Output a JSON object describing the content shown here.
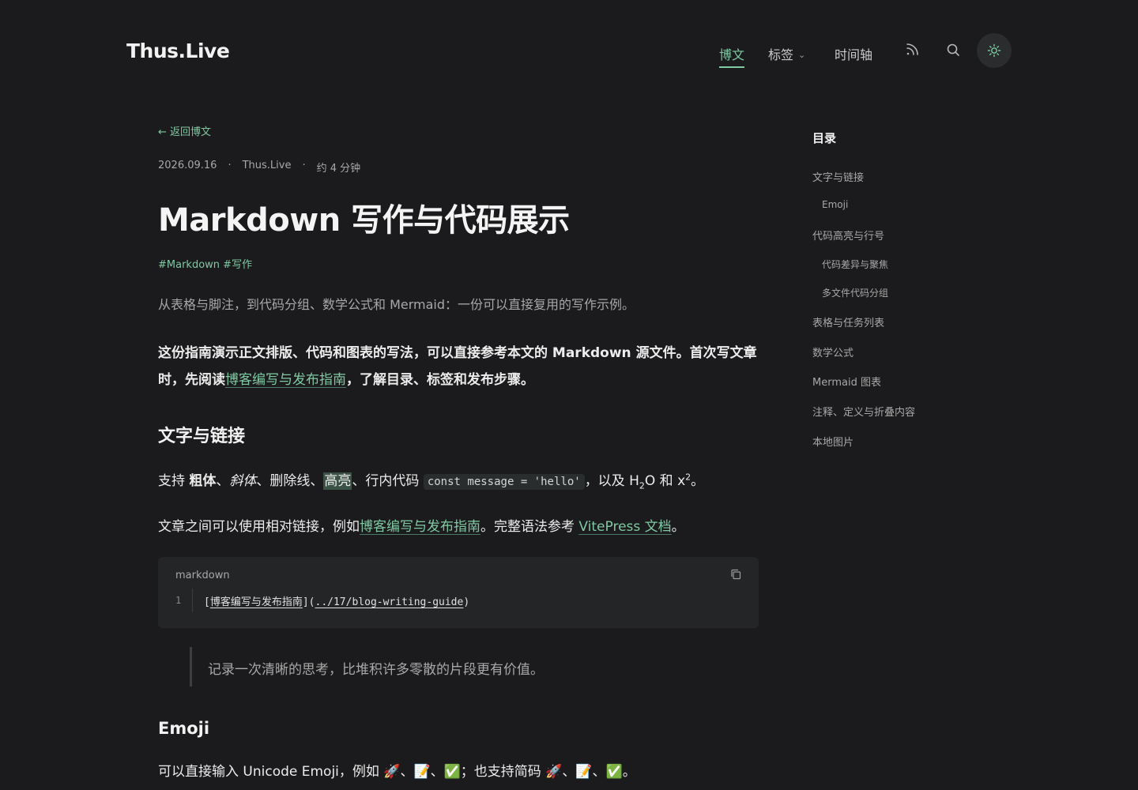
{
  "site": {
    "logo": "Thus.Live",
    "nav": {
      "posts": "博文",
      "tags": "标签",
      "timeline": "时间轴"
    },
    "icons": [
      "rss-icon",
      "search-icon",
      "sun-icon"
    ],
    "accent_color": "#7fc9a3"
  },
  "article": {
    "back_label": "← 返回博文",
    "meta": {
      "date": "2026.09.16",
      "author": "Thus.Live",
      "read_time": "约 4 分钟"
    },
    "title": "Markdown 写作与代码展示",
    "tags": [
      "#Markdown",
      "#写作"
    ],
    "summary": "从表格与脚注，到代码分组、数学公式和 Mermaid：一份可以直接复用的写作示例。",
    "intro": {
      "part1": "这份指南演示正文排版、代码和图表的写法，可以直接参考本文的 Markdown 源文件。首次写文章时，先阅读",
      "link": "博客编写与发布指南",
      "part2": "，了解目录、标签和发布步骤。"
    },
    "section1": {
      "heading": "文字与链接",
      "p1": {
        "t1": "支持 ",
        "bold": "粗体",
        "t2": "、",
        "italic": "斜体",
        "t3": "、",
        "strike": "删除线",
        "t4": "、",
        "mark": "高亮",
        "t5": "、行内代码 ",
        "code": "const message = 'hello'",
        "t6": "，以及 H",
        "sub": "2",
        "t7": "O 和 x",
        "sup": "2",
        "t8": "。"
      },
      "p2": {
        "t1": "文章之间可以使用相对链接，例如",
        "link1": "博客编写与发布指南",
        "t2": "。完整语法参考 ",
        "link2": "VitePress 文档",
        "t3": "。"
      },
      "code": {
        "lang": "markdown",
        "line_no": "1",
        "open_bracket": "[",
        "text": "博客编写与发布指南",
        "mid": "](",
        "url": "../17/blog-writing-guide",
        "close": ")"
      },
      "quote": "记录一次清晰的思考，比堆积许多零散的片段更有价值。"
    },
    "section2": {
      "heading": "Emoji",
      "p1": "可以直接输入 Unicode Emoji，例如 🚀、📝、✅；也支持简码 🚀、📝、✅。"
    }
  },
  "toc": {
    "title": "目录",
    "items": [
      {
        "label": "文字与链接",
        "level": 1
      },
      {
        "label": "Emoji",
        "level": 2
      },
      {
        "label": "代码高亮与行号",
        "level": 1
      },
      {
        "label": "代码差异与聚焦",
        "level": 2
      },
      {
        "label": "多文件代码分组",
        "level": 2
      },
      {
        "label": "表格与任务列表",
        "level": 1
      },
      {
        "label": "数学公式",
        "level": 1
      },
      {
        "label": "Mermaid 图表",
        "level": 1
      },
      {
        "label": "注释、定义与折叠内容",
        "level": 1
      },
      {
        "label": "本地图片",
        "level": 1
      }
    ]
  }
}
